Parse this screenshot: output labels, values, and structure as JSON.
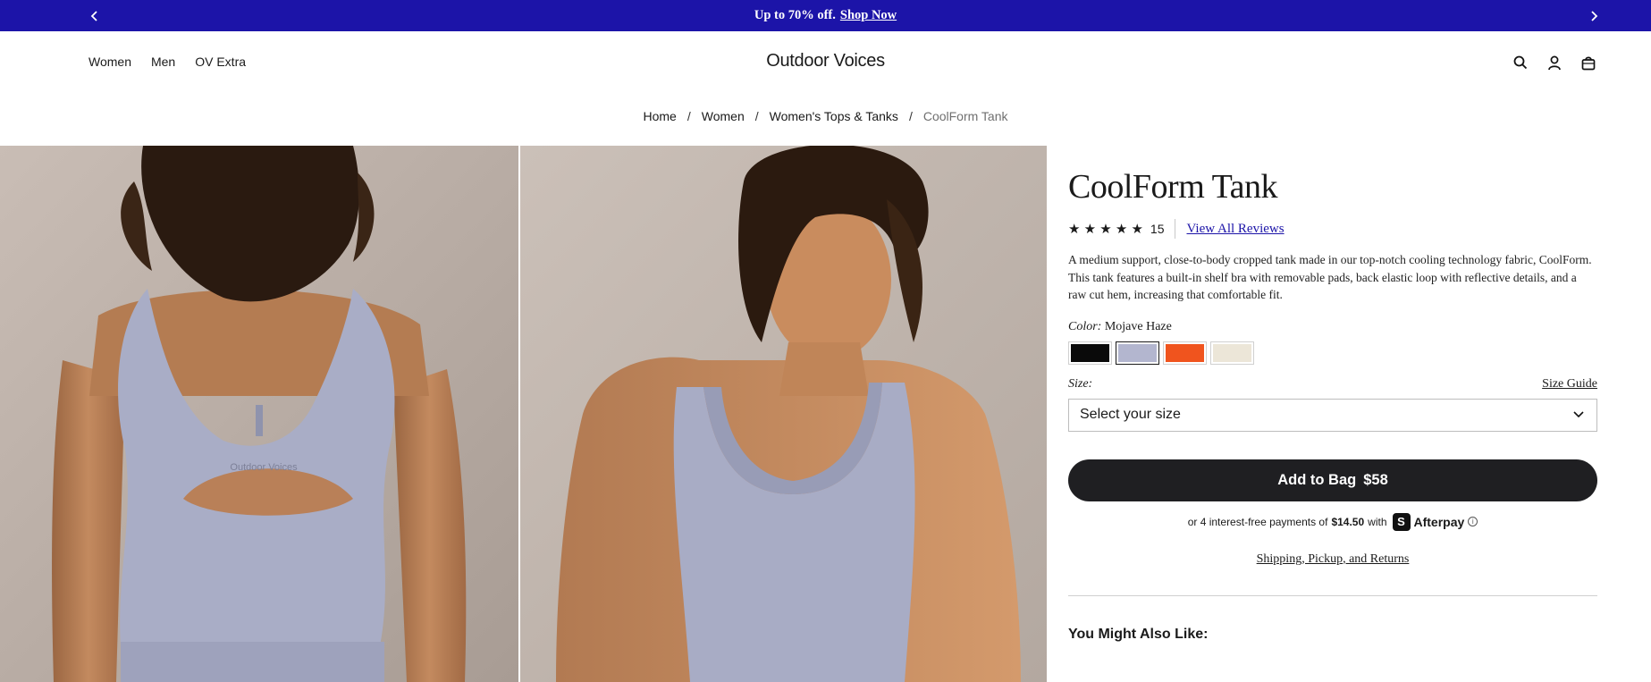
{
  "promo": {
    "message": "Up to 70% off.",
    "link": "Shop Now",
    "prev_icon": "chevron-left-icon",
    "next_icon": "chevron-right-icon",
    "bg_color": "#1c14a8"
  },
  "header": {
    "nav": [
      "Women",
      "Men",
      "OV Extra"
    ],
    "logo": "Outdoor Voices",
    "icons": [
      "search-icon",
      "account-icon",
      "bag-icon"
    ]
  },
  "breadcrumb": {
    "items": [
      "Home",
      "Women",
      "Women's Tops & Tanks"
    ],
    "current": "CoolForm Tank",
    "separator": "/"
  },
  "gallery": {
    "images": [
      "back-view-model-image",
      "front-view-model-image"
    ]
  },
  "product": {
    "title": "CoolForm Tank",
    "rating": 5,
    "stars": "★ ★ ★ ★ ★",
    "review_count": "15",
    "reviews_link": "View All Reviews",
    "description": "A medium support, close-to-body cropped tank made in our top-notch cooling technology fabric, CoolForm. This tank features a built-in shelf bra with removable pads, back elastic loop with reflective details, and a raw cut hem, increasing that comfortable fit.",
    "color_label": "Color:",
    "color_value": "Mojave Haze",
    "swatches": [
      {
        "name": "black",
        "color": "#0a0a0a"
      },
      {
        "name": "mojave-haze",
        "color": "#b3b6cf"
      },
      {
        "name": "orange",
        "color": "#f0541e"
      },
      {
        "name": "cream",
        "color": "#ece6d8"
      }
    ],
    "selected_swatch": "mojave-haze",
    "size_label": "Size:",
    "size_guide": "Size Guide",
    "size_placeholder": "Select your size",
    "add_to_bag": "Add to Bag",
    "price": "$58",
    "afterpay_prefix": "or 4 interest-free payments of",
    "afterpay_amount": "$14.50",
    "afterpay_with": "with",
    "afterpay_name": "Afterpay",
    "afterpay_badge": "S",
    "shipping_link": "Shipping, Pickup, and Returns",
    "also_like": "You Might Also Like:"
  }
}
